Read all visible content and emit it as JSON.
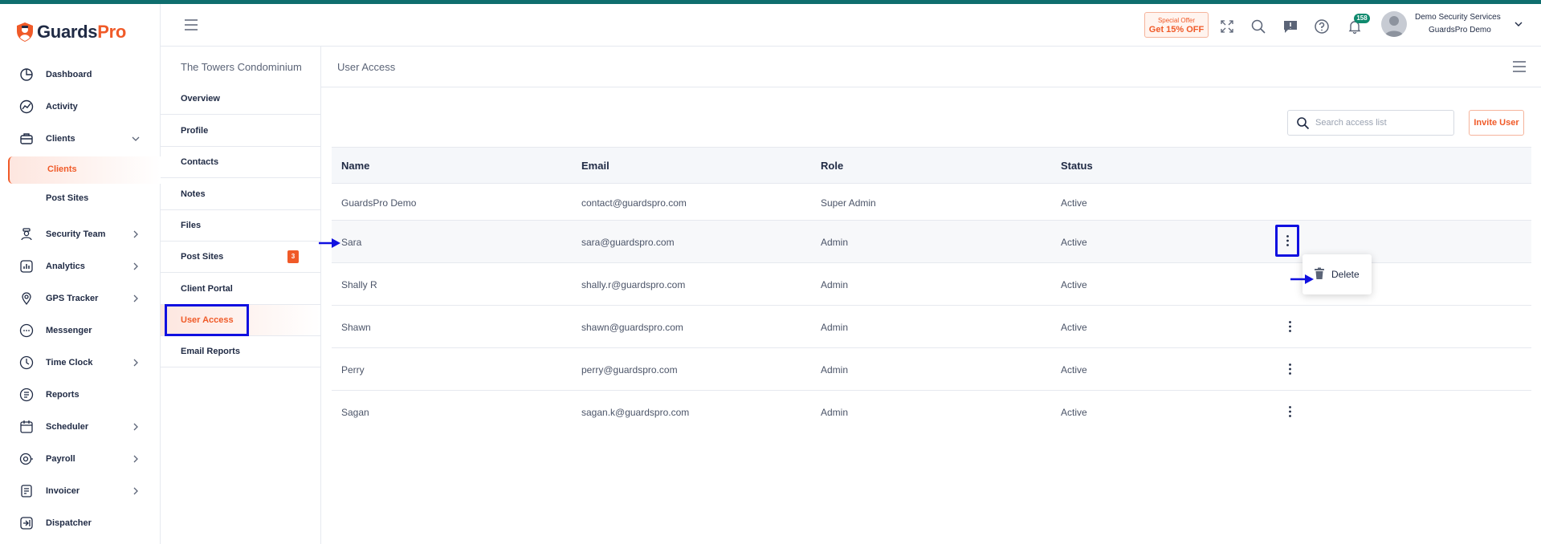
{
  "brand": {
    "part1": "Guards",
    "part2": "Pro",
    "accent": "#f05a28",
    "topbar_color": "#0f6e6e"
  },
  "sidebar": {
    "items": [
      {
        "label": "Dashboard",
        "icon": "pie-chart-icon",
        "chevron": false
      },
      {
        "label": "Activity",
        "icon": "activity-chart-icon",
        "chevron": false
      },
      {
        "label": "Clients",
        "icon": "briefcase-icon",
        "chevron": "down"
      },
      {
        "label": "Security Team",
        "icon": "guard-icon",
        "chevron": "right"
      },
      {
        "label": "Analytics",
        "icon": "bar-chart-icon",
        "chevron": "right"
      },
      {
        "label": "GPS Tracker",
        "icon": "map-pin-icon",
        "chevron": "right"
      },
      {
        "label": "Messenger",
        "icon": "chat-icon",
        "chevron": false
      },
      {
        "label": "Time Clock",
        "icon": "clock-icon",
        "chevron": "right"
      },
      {
        "label": "Reports",
        "icon": "report-icon",
        "chevron": false
      },
      {
        "label": "Scheduler",
        "icon": "calendar-icon",
        "chevron": "right"
      },
      {
        "label": "Payroll",
        "icon": "payroll-icon",
        "chevron": "right"
      },
      {
        "label": "Invoicer",
        "icon": "invoice-icon",
        "chevron": "right"
      },
      {
        "label": "Dispatcher",
        "icon": "dispatch-icon",
        "chevron": false
      }
    ],
    "subitems": [
      {
        "label": "Clients",
        "active": true
      },
      {
        "label": "Post Sites",
        "active": false
      }
    ]
  },
  "header": {
    "offer_line1": "Special Offer",
    "offer_line2": "Get 15% OFF",
    "notifications_count": "158",
    "user_name": "Demo Security Services",
    "user_org": "GuardsPro Demo"
  },
  "subnav": {
    "title": "The Towers Condominium",
    "items": [
      {
        "label": "Overview"
      },
      {
        "label": "Profile"
      },
      {
        "label": "Contacts"
      },
      {
        "label": "Notes"
      },
      {
        "label": "Files"
      },
      {
        "label": "Post Sites",
        "badge": "3"
      },
      {
        "label": "Client Portal"
      },
      {
        "label": "User Access",
        "active": true
      },
      {
        "label": "Email Reports"
      }
    ]
  },
  "main": {
    "title": "User Access",
    "search_placeholder": "Search access list",
    "invite_label": "Invite User",
    "columns": [
      "Name",
      "Email",
      "Role",
      "Status"
    ],
    "rows": [
      {
        "name": "GuardsPro Demo",
        "email": "contact@guardspro.com",
        "role": "Super Admin",
        "status": "Active"
      },
      {
        "name": "Sara",
        "email": "sara@guardspro.com",
        "role": "Admin",
        "status": "Active"
      },
      {
        "name": "Shally R",
        "email": "shally.r@guardspro.com",
        "role": "Admin",
        "status": "Active"
      },
      {
        "name": "Shawn",
        "email": "shawn@guardspro.com",
        "role": "Admin",
        "status": "Active"
      },
      {
        "name": "Perry",
        "email": "perry@guardspro.com",
        "role": "Admin",
        "status": "Active"
      },
      {
        "name": "Sagan",
        "email": "sagan.k@guardspro.com",
        "role": "Admin",
        "status": "Active"
      }
    ],
    "row_menu": {
      "delete_label": "Delete"
    }
  },
  "annotation_color": "#1010e0"
}
